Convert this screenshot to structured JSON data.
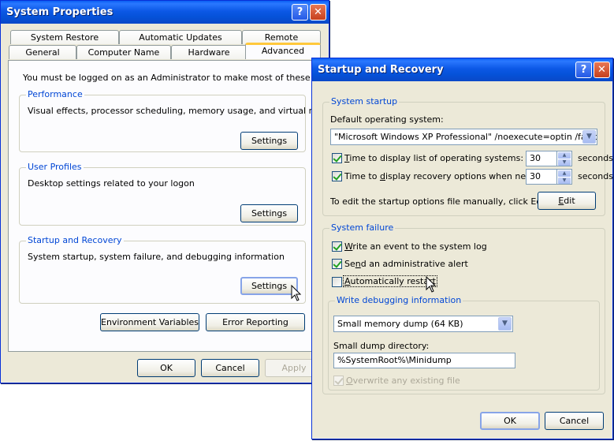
{
  "sysprops": {
    "title": "System Properties",
    "help_glyph": "?",
    "close_glyph": "✕",
    "tabs_row1": [
      "System Restore",
      "Automatic Updates",
      "Remote"
    ],
    "tabs_row2": [
      "General",
      "Computer Name",
      "Hardware",
      "Advanced"
    ],
    "active_tab": "Advanced",
    "admin_notice": "You must be logged on as an Administrator to make most of these changes.",
    "performance": {
      "label": "Performance",
      "description": "Visual effects, processor scheduling, memory usage, and virtual memory",
      "button": "Settings"
    },
    "user_profiles": {
      "label": "User Profiles",
      "description": "Desktop settings related to your logon",
      "button": "Settings"
    },
    "startup_recovery": {
      "label": "Startup and Recovery",
      "description": "System startup, system failure, and debugging information",
      "button": "Settings"
    },
    "env_vars_button": "Environment Variables",
    "error_reporting_button": "Error Reporting",
    "ok": "OK",
    "cancel": "Cancel",
    "apply": "Apply"
  },
  "startup": {
    "title": "Startup and Recovery",
    "help_glyph": "?",
    "close_glyph": "✕",
    "system_startup": {
      "label": "System startup",
      "default_os_label": "Default operating system:",
      "default_os_value": "\"Microsoft Windows XP Professional\" /noexecute=optin /fastdetect",
      "time_list_pre": "",
      "time_list_ul": "T",
      "time_list_post": "ime to display list of operating systems:",
      "time_list_value": "30",
      "time_recovery_pre": "Time to ",
      "time_recovery_ul": "d",
      "time_recovery_post": "isplay recovery options when needed:",
      "time_recovery_value": "30",
      "seconds": "seconds",
      "edit_hint": "To edit the startup options file manually, click Edit.",
      "edit_pre": "",
      "edit_ul": "E",
      "edit_post": "dit"
    },
    "system_failure": {
      "label": "System failure",
      "write_event_pre": "",
      "write_event_ul": "W",
      "write_event_post": "rite an event to the system log",
      "send_alert_pre": "Se",
      "send_alert_ul": "n",
      "send_alert_post": "d an administrative alert",
      "auto_restart_pre": "",
      "auto_restart_ul": "A",
      "auto_restart_post": "utomatically restart",
      "debug": {
        "label": "Write debugging information",
        "dump_type": "Small memory dump (64 KB)",
        "dir_label": "Small dump directory:",
        "dir_value": "%SystemRoot%\\Minidump",
        "overwrite_pre": "",
        "overwrite_ul": "O",
        "overwrite_post": "verwrite any existing file"
      }
    },
    "ok": "OK",
    "cancel": "Cancel"
  }
}
